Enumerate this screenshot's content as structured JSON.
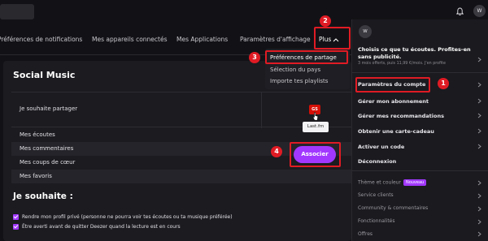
{
  "topbar": {
    "avatar_initial": "W"
  },
  "tabs": [
    {
      "label": "Préférences de notifications"
    },
    {
      "label": "Mes appareils connectés"
    },
    {
      "label": "Mes Applications"
    },
    {
      "label": "Paramètres d'affichage"
    },
    {
      "label": "Plus"
    }
  ],
  "plus_menu": {
    "items": [
      {
        "label": "Préférences de partage"
      },
      {
        "label": "Sélection du pays"
      },
      {
        "label": "Importe tes playlists"
      }
    ]
  },
  "social": {
    "title": "Social Music",
    "share_label": "Je souhaite partager",
    "lastfm_icon_text": "GS",
    "tooltip": "Last.fm",
    "rows": [
      {
        "label": "Mes écoutes"
      },
      {
        "label": "Mes commentaires"
      },
      {
        "label": "Mes coups de cœur"
      },
      {
        "label": "Mes favoris"
      }
    ],
    "associate_button": "Associer"
  },
  "wishes": {
    "title": "Je souhaite :",
    "options": [
      {
        "label": "Rendre mon profil privé (personne ne pourra voir tes écoutes ou ta musique préférée)",
        "checked": true
      },
      {
        "label": "Être averti avant de quitter Deezer quand la lecture est en cours",
        "checked": true
      }
    ]
  },
  "account_menu": {
    "avatar_initial": "W",
    "promo_title": "Choisis ce que tu écoutes. Profites-en sans publicité.",
    "promo_sub": "3 mois offerts, puis 11,99 €/mois. J'en profite",
    "items": [
      {
        "label": "Paramètres du compte"
      },
      {
        "label": "Gérer mon abonnement"
      },
      {
        "label": "Gérer mes recommandations"
      },
      {
        "label": "Obtenir une carte-cadeau"
      },
      {
        "label": "Activer un code"
      },
      {
        "label": "Déconnexion"
      }
    ],
    "sub_items": [
      {
        "label": "Thème et couleur",
        "badge": "Nouveau"
      },
      {
        "label": "Service clients"
      },
      {
        "label": "Community & commentaires"
      },
      {
        "label": "Fonctionnalités"
      },
      {
        "label": "Offres"
      }
    ]
  },
  "markers": [
    "1",
    "2",
    "3",
    "4"
  ],
  "colors": {
    "accent": "#a238ff",
    "highlight": "#e01b24",
    "lastfm": "#d51007"
  }
}
